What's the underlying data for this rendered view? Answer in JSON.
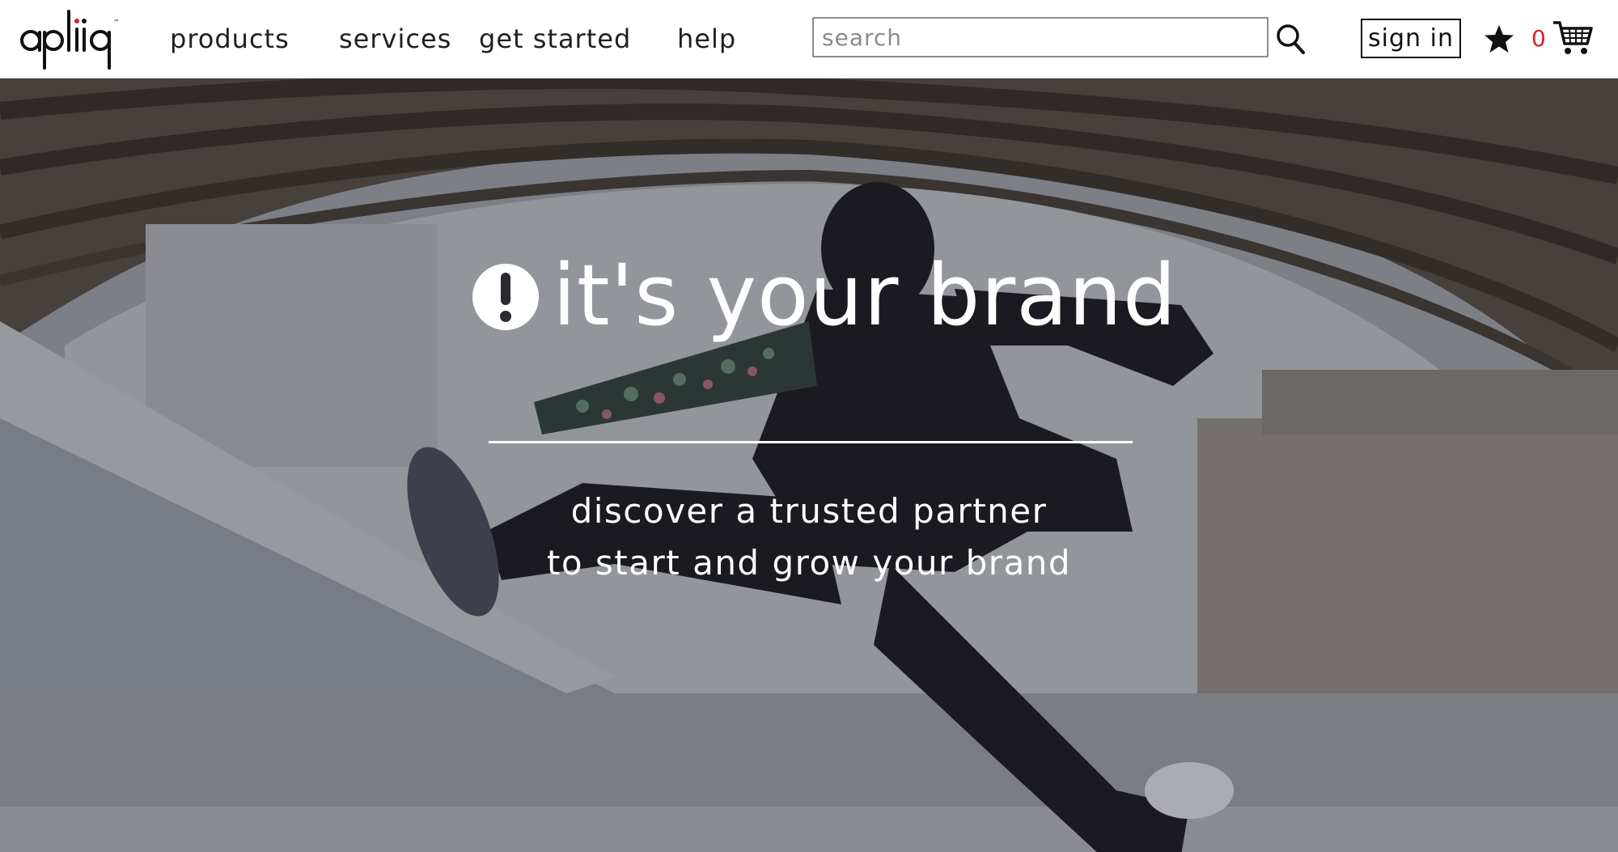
{
  "brand": {
    "logo_text": "apliiq",
    "logo_mark": "™"
  },
  "nav": {
    "items": [
      {
        "label": "products"
      },
      {
        "label": "services"
      },
      {
        "label": "get started"
      },
      {
        "label": "help"
      }
    ]
  },
  "search": {
    "placeholder": "search",
    "value": "",
    "icon": "search-icon"
  },
  "account": {
    "signin_label": "sign in",
    "favorites_icon": "star-icon",
    "cart_count": "0",
    "cart_icon": "cart-icon"
  },
  "hero": {
    "alert_icon": "exclamation-circle-icon",
    "headline": "it's your brand",
    "tagline_line1": "discover a trusted partner",
    "tagline_line2": "to start and grow your brand"
  },
  "colors": {
    "accent_red": "#e0202a",
    "text_dark": "#1f1f1f",
    "hero_text": "#ffffff"
  }
}
